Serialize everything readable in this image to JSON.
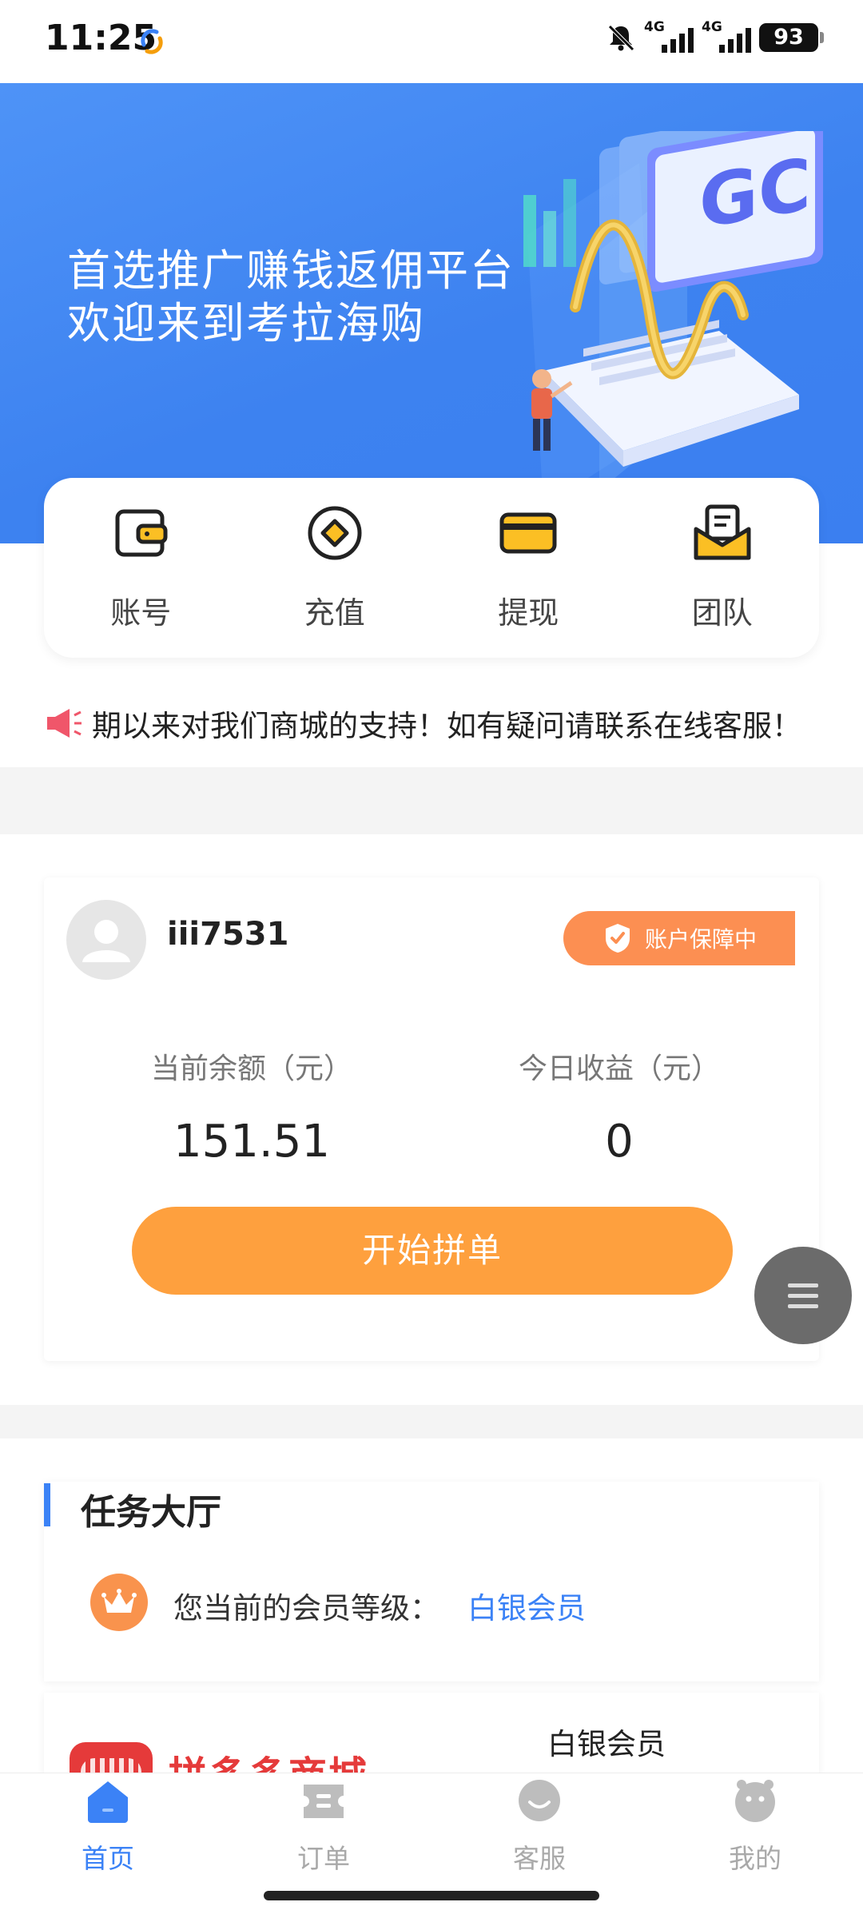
{
  "status_bar": {
    "time": "11:25",
    "network_1": "4G",
    "network_2": "4G",
    "battery": "93"
  },
  "banner": {
    "line1": "首选推广赚钱返佣平台",
    "line2": "欢迎来到考拉海购",
    "art_text": "GC"
  },
  "quick_actions": [
    {
      "label": "账号",
      "icon": "wallet-icon"
    },
    {
      "label": "充值",
      "icon": "recharge-icon"
    },
    {
      "label": "提现",
      "icon": "card-icon"
    },
    {
      "label": "团队",
      "icon": "envelope-icon"
    }
  ],
  "notice": {
    "icon": "megaphone-icon",
    "text": "期以来对我们商城的支持！如有疑问请联系在线客服！"
  },
  "account": {
    "username": "iii7531",
    "protect_label": "账户保障中",
    "balance_label": "当前余额（元）",
    "balance_value": "151.51",
    "income_label": "今日收益（元）",
    "income_value": "0",
    "start_button": "开始拼单"
  },
  "task_hall": {
    "title": "任务大厅",
    "level_label": "您当前的会员等级：",
    "level_value": "白银会员"
  },
  "shop": {
    "name": "拼多多商城",
    "level": "白银会员"
  },
  "bottom_nav": [
    {
      "label": "首页",
      "icon": "home-icon",
      "active": true
    },
    {
      "label": "订单",
      "icon": "order-icon",
      "active": false
    },
    {
      "label": "客服",
      "icon": "service-icon",
      "active": false
    },
    {
      "label": "我的",
      "icon": "profile-icon",
      "active": false
    }
  ],
  "colors": {
    "primary_blue": "#3b82f6",
    "banner_blue": "#4a8ef5",
    "orange_button": "#fea03e",
    "badge_orange": "#fc8f52",
    "shop_red": "#e53a3a"
  }
}
